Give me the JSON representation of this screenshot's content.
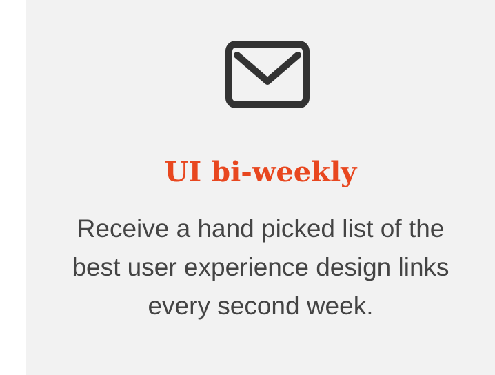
{
  "newsletter": {
    "icon": "envelope-icon",
    "title": "UI bi-weekly",
    "description": "Receive a hand picked list of the best user experience design links every second week.",
    "title_color": "#e8471f",
    "background_color": "#f2f2f2"
  }
}
